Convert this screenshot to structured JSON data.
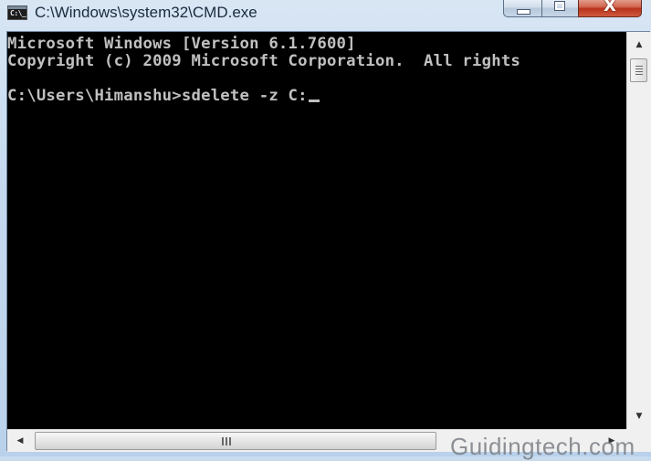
{
  "window": {
    "title": "C:\\Windows\\system32\\CMD.exe",
    "app_icon_text": "C:\\_",
    "controls": {
      "minimize_icon": "minimize-icon",
      "maximize_icon": "maximize-icon",
      "close_glyph": "X"
    }
  },
  "console": {
    "lines": [
      "Microsoft Windows [Version 6.1.7600]",
      "Copyright (c) 2009 Microsoft Corporation.  All rights",
      "",
      "C:\\Users\\Himanshu>sdelete -z C:"
    ],
    "prompt": "C:\\Users\\Himanshu>",
    "command": "sdelete -z C:",
    "colors": {
      "background": "#000000",
      "foreground": "#c0c0c0"
    }
  },
  "scrollbars": {
    "vertical": {
      "up_glyph": "▲",
      "down_glyph": "▼"
    },
    "horizontal": {
      "left_glyph": "◀",
      "right_glyph": "▶"
    }
  },
  "watermark": "Guidingtech.com"
}
